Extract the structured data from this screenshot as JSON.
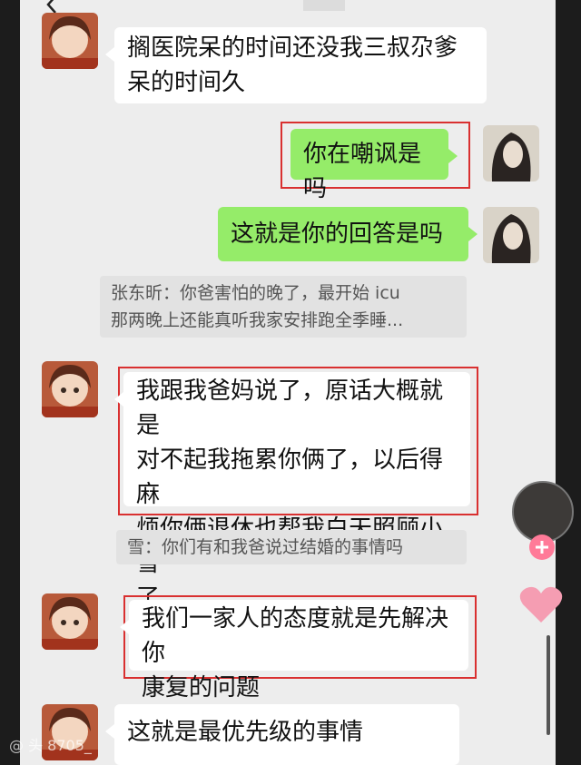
{
  "messages": [
    {
      "side": "left",
      "text": "搁医院呆的时间还没我三叔尕爹呆的时间久"
    },
    {
      "side": "right",
      "text": "你在嘲讽是吗",
      "highlighted": true
    },
    {
      "side": "right",
      "text": "这就是你的回答是吗"
    },
    {
      "type": "quote",
      "text": "张东昕：你爸害怕的晚了，最开始icu那两晚上还能真听我家安排跑全季睡..."
    },
    {
      "side": "left",
      "text": "我跟我爸妈说了，原话大概就是对不起我拖累你俩了，以后得麻烦你俩退休也帮我白天照顾小雪了",
      "highlighted": true
    },
    {
      "type": "quote",
      "text": "雪：你们有和我爸说过结婚的事情吗"
    },
    {
      "side": "left",
      "text": "我们一家人的态度就是先解决你康复的问题",
      "highlighted": true
    },
    {
      "side": "left",
      "text": "这就是最优先级的事情"
    }
  ],
  "display": {
    "m1_line1": "搁医院呆的时间还没我三叔尕爹",
    "m1_line2": "呆的时间久",
    "m2": "你在嘲讽是吗",
    "m3": "这就是你的回答是吗",
    "q1_line1": "张东昕：你爸害怕的晚了，最开始 icu",
    "q1_line2": "那两晚上还能真听我家安排跑全季睡...",
    "m4_line1": "我跟我爸妈说了，原话大概就是",
    "m4_line2": "对不起我拖累你俩了，以后得麻",
    "m4_line3": "烦你俩退休也帮我白天照顾小雪",
    "m4_line4": "了",
    "q2": "雪：你们有和我爸说过结婚的事情吗",
    "m5_line1": "我们一家人的态度就是先解决你",
    "m5_line2": "康复的问题",
    "m6": "这就是最优先级的事情",
    "watermark": "@ 头 8705_"
  },
  "colors": {
    "bubble_green": "#95ec69",
    "bubble_white": "#ffffff",
    "highlight": "#d93030",
    "background": "#ededed"
  },
  "icons": [
    "back-icon",
    "user-avatar-icon",
    "contact-avatar-icon",
    "plus-icon",
    "heart-icon"
  ]
}
